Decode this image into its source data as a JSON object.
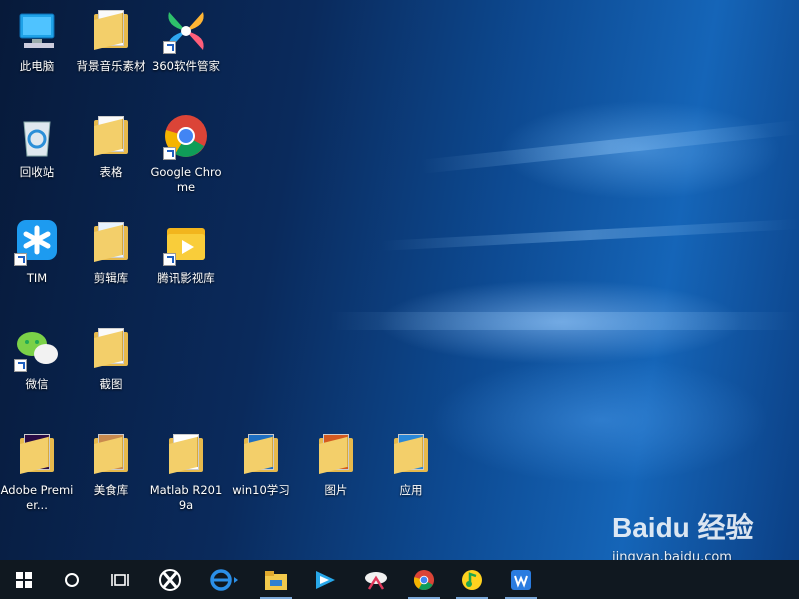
{
  "desktop": {
    "icons": [
      {
        "label": "此电脑",
        "icon": "this-pc-icon"
      },
      {
        "label": "背景音乐素材",
        "icon": "folder-icon"
      },
      {
        "label": "360软件管家",
        "icon": "360-software-manager-icon",
        "shortcut": true
      },
      {
        "label": "回收站",
        "icon": "recycle-bin-icon"
      },
      {
        "label": "表格",
        "icon": "folder-icon"
      },
      {
        "label": "Google Chrome",
        "icon": "chrome-icon",
        "shortcut": true
      },
      {
        "label": "TIM",
        "icon": "tim-icon",
        "shortcut": true
      },
      {
        "label": "剪辑库",
        "icon": "folder-icon"
      },
      {
        "label": "腾讯影视库",
        "icon": "tencent-video-library-icon",
        "shortcut": true
      },
      {
        "label": "微信",
        "icon": "wechat-icon",
        "shortcut": true
      },
      {
        "label": "截图",
        "icon": "folder-icon"
      },
      {
        "label": "Adobe Premier...",
        "icon": "premiere-folder-icon"
      },
      {
        "label": "美食库",
        "icon": "folder-icon"
      },
      {
        "label": "Matlab R2019a",
        "icon": "matlab-folder-icon"
      },
      {
        "label": "win10学习",
        "icon": "folder-icon"
      },
      {
        "label": "图片",
        "icon": "folder-icon"
      },
      {
        "label": "应用",
        "icon": "folder-icon"
      }
    ]
  },
  "taskbar": {
    "items": [
      {
        "name": "start",
        "icon": "windows-start-icon"
      },
      {
        "name": "search",
        "icon": "search-circle-icon"
      },
      {
        "name": "task-view",
        "icon": "task-view-icon"
      },
      {
        "name": "360",
        "icon": "360-icon"
      },
      {
        "name": "ie",
        "icon": "internet-explorer-icon"
      },
      {
        "name": "file-explorer",
        "icon": "file-explorer-icon"
      },
      {
        "name": "tencent-video",
        "icon": "tencent-video-icon"
      },
      {
        "name": "snipping",
        "icon": "snipping-tool-icon"
      },
      {
        "name": "chrome",
        "icon": "chrome-icon"
      },
      {
        "name": "qq-music",
        "icon": "qq-music-icon"
      },
      {
        "name": "wps",
        "icon": "wps-icon"
      }
    ]
  },
  "watermark": {
    "brand": "Baidu 经验",
    "url": "jingyan.baidu.com"
  }
}
